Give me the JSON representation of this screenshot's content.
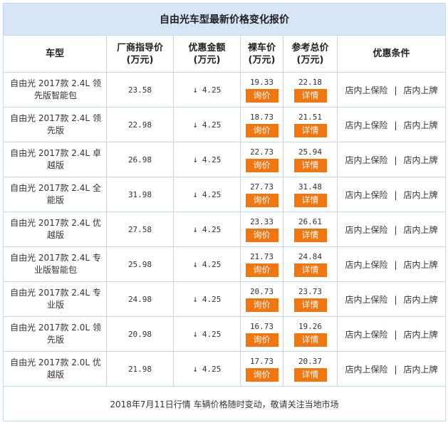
{
  "title": "自由光车型最新价格变化报价",
  "headers": {
    "model": "车型",
    "msrp_line1": "厂商指导价",
    "msrp_line2": "(万元)",
    "discount_line1": "优惠金额",
    "discount_line2": "(万元)",
    "net_line1": "裸车价",
    "net_line2": "(万元)",
    "total_line1": "参考总价",
    "total_line2": "(万元)",
    "conditions": "优惠条件"
  },
  "buttons": {
    "inquiry": "询价",
    "details": "详情"
  },
  "arrow_symbol": "↓",
  "conditions_sep": "|",
  "rows": [
    {
      "model": "自由光 2017款 2.4L 领先版智能包",
      "msrp": "23.58",
      "discount": "4.25",
      "net": "19.33",
      "total": "22.18",
      "cond1": "店内上保险",
      "cond2": "店内上牌"
    },
    {
      "model": "自由光 2017款 2.4L 领先版",
      "msrp": "22.98",
      "discount": "4.25",
      "net": "18.73",
      "total": "21.51",
      "cond1": "店内上保险",
      "cond2": "店内上牌"
    },
    {
      "model": "自由光 2017款 2.4L 卓越版",
      "msrp": "26.98",
      "discount": "4.25",
      "net": "22.73",
      "total": "25.94",
      "cond1": "店内上保险",
      "cond2": "店内上牌"
    },
    {
      "model": "自由光 2017款 2.4L 全能版",
      "msrp": "31.98",
      "discount": "4.25",
      "net": "27.73",
      "total": "31.48",
      "cond1": "店内上保险",
      "cond2": "店内上牌"
    },
    {
      "model": "自由光 2017款 2.4L 优越版",
      "msrp": "27.58",
      "discount": "4.25",
      "net": "23.33",
      "total": "26.61",
      "cond1": "店内上保险",
      "cond2": "店内上牌"
    },
    {
      "model": "自由光 2017款 2.4L 专业版智能包",
      "msrp": "25.98",
      "discount": "4.25",
      "net": "21.73",
      "total": "24.84",
      "cond1": "店内上保险",
      "cond2": "店内上牌"
    },
    {
      "model": "自由光 2017款 2.4L 专业版",
      "msrp": "24.98",
      "discount": "4.25",
      "net": "20.73",
      "total": "23.73",
      "cond1": "店内上保险",
      "cond2": "店内上牌"
    },
    {
      "model": "自由光 2017款 2.0L 领先版",
      "msrp": "20.98",
      "discount": "4.25",
      "net": "16.73",
      "total": "19.26",
      "cond1": "店内上保险",
      "cond2": "店内上牌"
    },
    {
      "model": "自由光 2017款 2.0L 优越版",
      "msrp": "21.98",
      "discount": "4.25",
      "net": "17.73",
      "total": "20.37",
      "cond1": "店内上保险",
      "cond2": "店内上牌"
    }
  ],
  "footer": "2018年7月11日行情 车辆价格随时变动，敬请关注当地市场",
  "colors": {
    "title_bg": "#d6e6f6",
    "border": "#c6d6e6",
    "button_bg": "#f2760f",
    "button_text": "#ffffff"
  }
}
